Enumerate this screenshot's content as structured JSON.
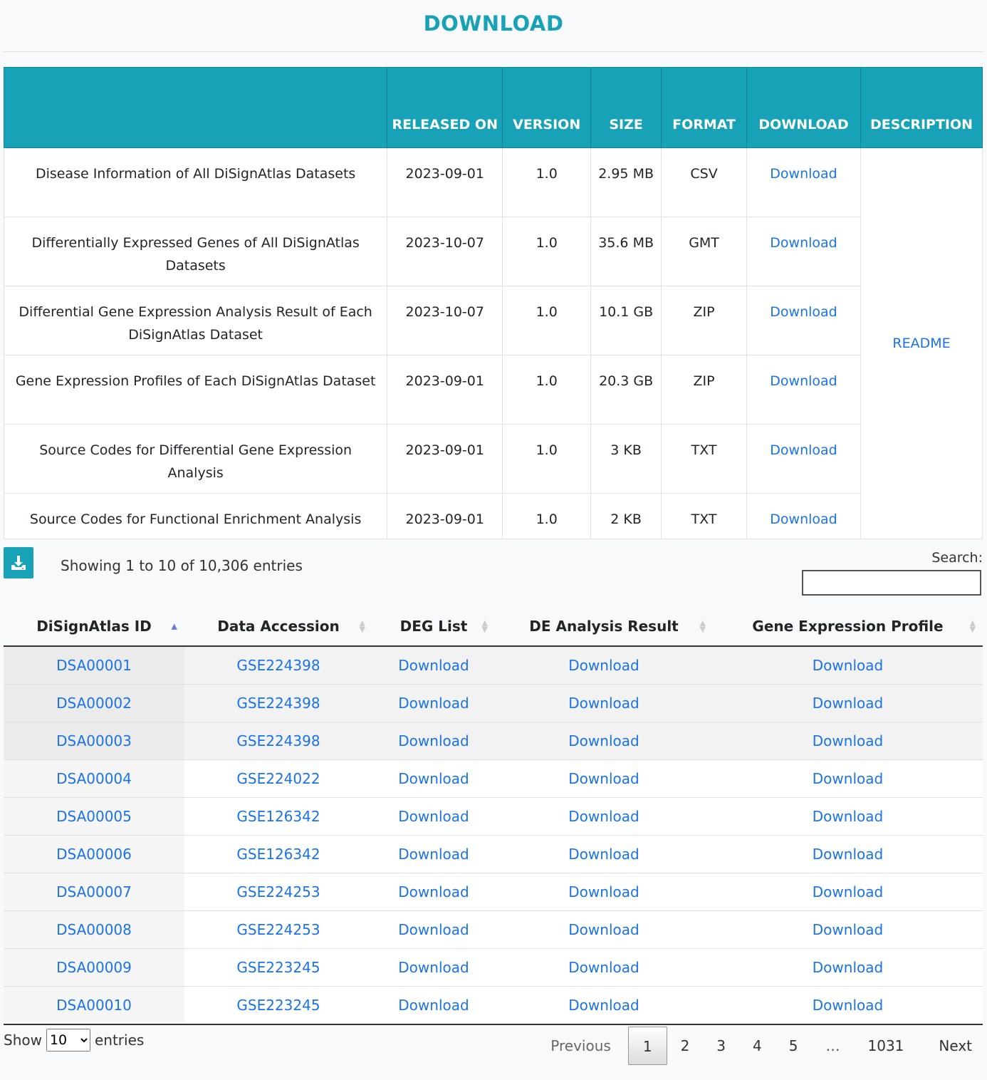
{
  "page_title": "DOWNLOAD",
  "files_table": {
    "headers": {
      "name": "",
      "released_on": "RELEASED ON",
      "version": "VERSION",
      "size": "SIZE",
      "format": "FORMAT",
      "download": "DOWNLOAD",
      "description": "DESCRIPTION"
    },
    "rows": [
      {
        "name": "Disease Information of All DiSignAtlas Datasets",
        "released": "2023-09-01",
        "version": "1.0",
        "size": "2.95 MB",
        "format": "CSV",
        "link": "Download"
      },
      {
        "name": "Differentially Expressed Genes of All DiSignAtlas Datasets",
        "released": "2023-10-07",
        "version": "1.0",
        "size": "35.6 MB",
        "format": "GMT",
        "link": "Download"
      },
      {
        "name": "Differential Gene Expression Analysis Result of Each DiSignAtlas Dataset",
        "released": "2023-10-07",
        "version": "1.0",
        "size": "10.1 GB",
        "format": "ZIP",
        "link": "Download"
      },
      {
        "name": "Gene Expression Profiles of Each DiSignAtlas Dataset",
        "released": "2023-09-01",
        "version": "1.0",
        "size": "20.3 GB",
        "format": "ZIP",
        "link": "Download"
      },
      {
        "name": "Source Codes for Differential Gene Expression Analysis",
        "released": "2023-09-01",
        "version": "1.0",
        "size": "3 KB",
        "format": "TXT",
        "link": "Download"
      },
      {
        "name": "Source Codes for Functional Enrichment Analysis",
        "released": "2023-09-01",
        "version": "1.0",
        "size": "2 KB",
        "format": "TXT",
        "link": "Download"
      }
    ],
    "readme_label": "README"
  },
  "toolbar": {
    "download_icon": "download-icon",
    "info": "Showing 1 to 10 of 10,306 entries",
    "search_label": "Search:",
    "search_value": ""
  },
  "data_table": {
    "headers": {
      "id": "DiSignAtlas ID",
      "accession": "Data Accession",
      "deg": "DEG List",
      "de_result": "DE Analysis Result",
      "profile": "Gene Expression Profile"
    },
    "rows": [
      {
        "id": "DSA00001",
        "acc": "GSE224398",
        "deg": "Download",
        "de": "Download",
        "prof": "Download"
      },
      {
        "id": "DSA00002",
        "acc": "GSE224398",
        "deg": "Download",
        "de": "Download",
        "prof": "Download"
      },
      {
        "id": "DSA00003",
        "acc": "GSE224398",
        "deg": "Download",
        "de": "Download",
        "prof": "Download"
      },
      {
        "id": "DSA00004",
        "acc": "GSE224022",
        "deg": "Download",
        "de": "Download",
        "prof": "Download"
      },
      {
        "id": "DSA00005",
        "acc": "GSE126342",
        "deg": "Download",
        "de": "Download",
        "prof": "Download"
      },
      {
        "id": "DSA00006",
        "acc": "GSE126342",
        "deg": "Download",
        "de": "Download",
        "prof": "Download"
      },
      {
        "id": "DSA00007",
        "acc": "GSE224253",
        "deg": "Download",
        "de": "Download",
        "prof": "Download"
      },
      {
        "id": "DSA00008",
        "acc": "GSE224253",
        "deg": "Download",
        "de": "Download",
        "prof": "Download"
      },
      {
        "id": "DSA00009",
        "acc": "GSE223245",
        "deg": "Download",
        "de": "Download",
        "prof": "Download"
      },
      {
        "id": "DSA00010",
        "acc": "GSE223245",
        "deg": "Download",
        "de": "Download",
        "prof": "Download"
      }
    ]
  },
  "footer": {
    "show_label": "Show",
    "entries_label": "entries",
    "page_length": "10",
    "pagination": {
      "previous": "Previous",
      "pages": [
        "1",
        "2",
        "3",
        "4",
        "5"
      ],
      "ellipsis": "…",
      "last": "1031",
      "next": "Next",
      "current": "1"
    }
  },
  "colors": {
    "accent": "#17a2b8",
    "link": "#1a73e8"
  }
}
